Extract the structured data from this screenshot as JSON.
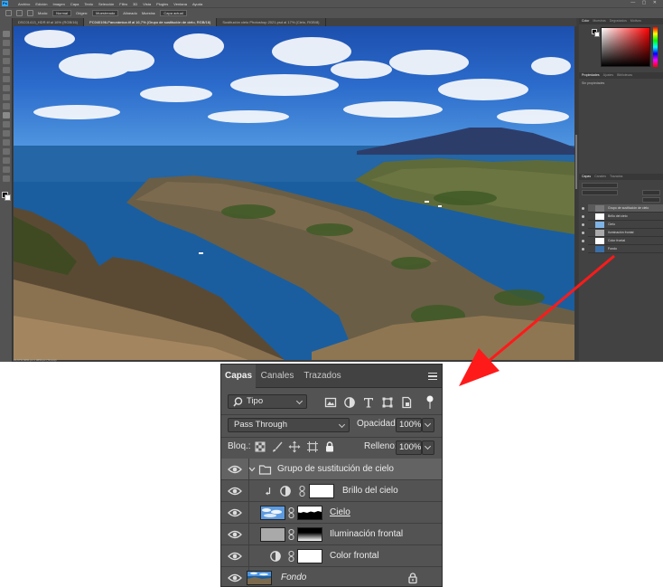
{
  "ps_window": {
    "app_logo": "Ps",
    "menu": [
      "Archivo",
      "Edición",
      "Imagen",
      "Capa",
      "Texto",
      "Selección",
      "Filtro",
      "3D",
      "Vista",
      "Plugins",
      "Ventana",
      "Ayuda"
    ],
    "options": {
      "mode_label": "Modo:",
      "mode_value": "Normal",
      "origin_label": "Origen:",
      "origin_value": "Muestreado",
      "sample_label": "Muestra:",
      "sample_value": "Capa actual",
      "toggle_label": "Alineado"
    },
    "doc_tabs": [
      "DSC01413_HDR.tif al 16% (RGB/16)",
      "PC040196-Panorámica.tif al 16,7% (Grupo de sustitución de cielo, RGB/16)",
      "Sustitución cielo Photoshop 2021.psd al 17% (Cielo, RGB/8)"
    ],
    "status": "16,67%   6051 px x 3654 px (72 ppp)",
    "color_tabs": [
      "Color",
      "Muestras",
      "Degradados",
      "Motivos"
    ],
    "props_tabs": [
      "Propiedades",
      "Ajustes",
      "Bibliotecas"
    ],
    "props_text": "Sin propiedades",
    "mini_layer_tabs": [
      "Capas",
      "Canales",
      "Trazados"
    ],
    "mini_layers": [
      "Grupo de sustitución de cielo",
      "Brillo del cielo",
      "Cielo",
      "Iluminación frontal",
      "Color frontal",
      "Fondo"
    ]
  },
  "layers_panel": {
    "tabs": [
      "Capas",
      "Canales",
      "Trazados"
    ],
    "filter_kind": "Tipo",
    "blend_mode": "Pass Through",
    "opacity_label": "Opacidad:",
    "opacity_value": "100%",
    "lock_label": "Bloq.:",
    "fill_label": "Relleno:",
    "fill_value": "100%",
    "layers": [
      {
        "name": "Grupo de sustitución de cielo",
        "kind": "group",
        "selected": true
      },
      {
        "name": "Brillo del cielo",
        "kind": "adjustment-clipped"
      },
      {
        "name": "Cielo",
        "kind": "image-mask"
      },
      {
        "name": "Iluminación frontal",
        "kind": "image-mask"
      },
      {
        "name": "Color frontal",
        "kind": "adjustment"
      },
      {
        "name": "Fondo",
        "kind": "background-locked"
      }
    ]
  },
  "colors": {
    "annotation_arrow": "#ff1a1a",
    "panel_bg": "#535353",
    "ps_blue": "#31a8ff"
  }
}
